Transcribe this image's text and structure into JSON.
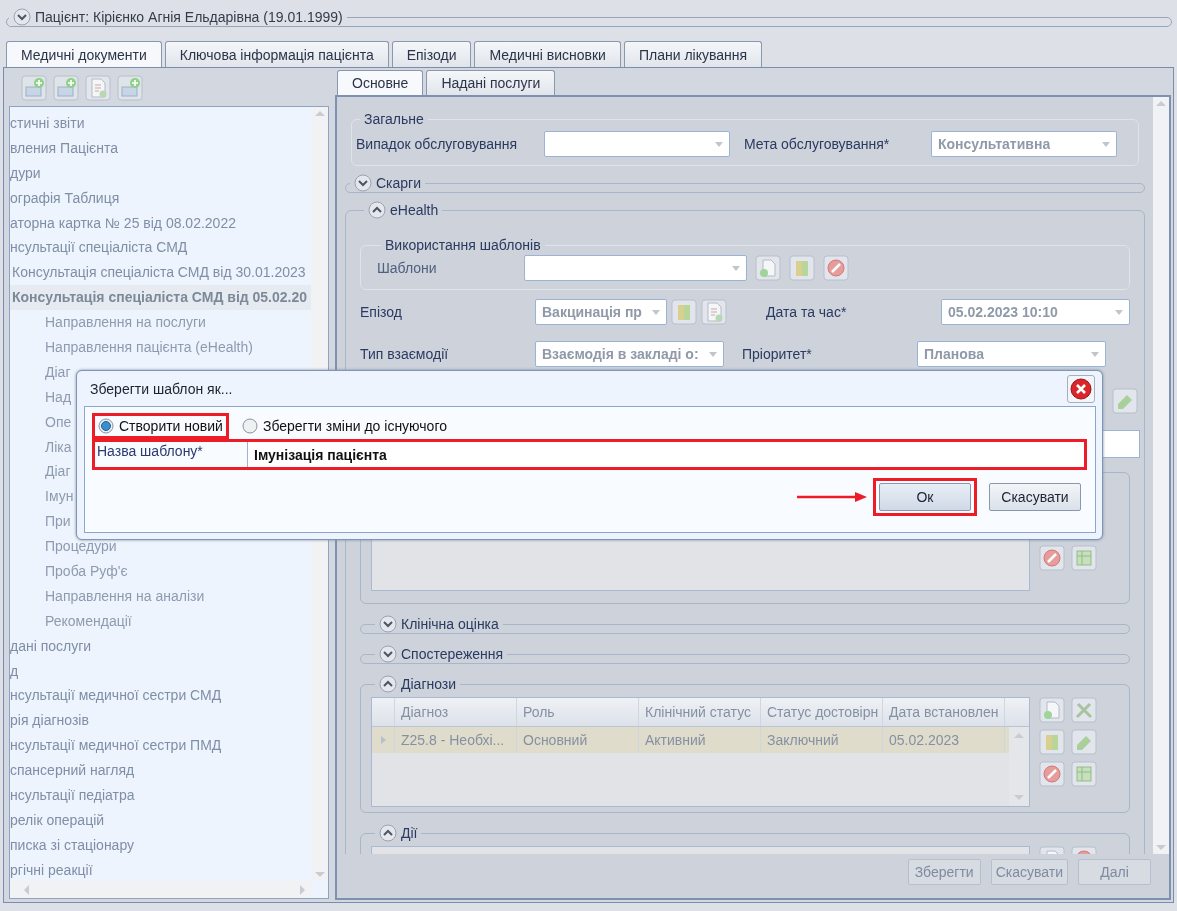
{
  "header": {
    "title": "Пацієнт: Кірієнко Агнія Ельдарівна (19.01.1999)",
    "expanded": false
  },
  "tabs": [
    {
      "label": "Медичні документи",
      "selected": true
    },
    {
      "label": "Ключова інформація пацієнта",
      "selected": false
    },
    {
      "label": "Епізоди",
      "selected": false
    },
    {
      "label": "Медичні висновки",
      "selected": false
    },
    {
      "label": "Плани лікування",
      "selected": false
    }
  ],
  "tree": {
    "items": [
      {
        "label": "стичні звіти",
        "selected": false
      },
      {
        "label": "вления Пацієнта",
        "selected": false
      },
      {
        "label": "дури",
        "selected": false
      },
      {
        "label": "ографія Таблиця",
        "selected": false
      },
      {
        "label": "аторна картка № 25 від 08.02.2022",
        "selected": false
      },
      {
        "label": "нсультації спеціаліста СМД",
        "selected": false,
        "children": [
          {
            "label": "Консультація спеціаліста СМД від 30.01.2023",
            "selected": false
          },
          {
            "label": "Консультація спеціаліста СМД від 05.02.20",
            "selected": true,
            "children": [
              {
                "label": "Направлення на послуги",
                "selected": false
              },
              {
                "label": "Направлення пацієнта (eHealth)",
                "selected": false
              },
              {
                "label": "Діаг",
                "selected": false
              },
              {
                "label": "Над",
                "selected": false
              },
              {
                "label": "Опе",
                "selected": false
              },
              {
                "label": "Ліка",
                "selected": false
              },
              {
                "label": "Діаг",
                "selected": false
              },
              {
                "label": "Імун",
                "selected": false
              },
              {
                "label": "При",
                "selected": false
              },
              {
                "label": "Процедури",
                "selected": false
              },
              {
                "label": "Проба Руф'є",
                "selected": false
              },
              {
                "label": "Направлення на аналізи",
                "selected": false
              },
              {
                "label": "Рекомендації",
                "selected": false
              }
            ]
          }
        ]
      },
      {
        "label": "дані послуги",
        "selected": false
      },
      {
        "label": "д",
        "selected": false
      },
      {
        "label": "нсультації медичної сестри СМД",
        "selected": false
      },
      {
        "label": "рія діагнозів",
        "selected": false
      },
      {
        "label": "нсультації медичної сестри ПМД",
        "selected": false
      },
      {
        "label": "спансерний нагляд",
        "selected": false
      },
      {
        "label": "нсультації педіатра",
        "selected": false
      },
      {
        "label": "релік операцій",
        "selected": false
      },
      {
        "label": "писка зі стаціонару",
        "selected": false
      },
      {
        "label": "ргічні реакції",
        "selected": false
      }
    ]
  },
  "subtabs": [
    {
      "label": "Основне",
      "selected": true
    },
    {
      "label": "Надані послуги",
      "selected": false
    }
  ],
  "general": {
    "title": "Загальне",
    "fields": [
      {
        "label": "Випадок обслуговування"
      },
      {
        "label": "Мета обслуговування*",
        "value": "Консультативна"
      }
    ]
  },
  "complaints": {
    "title": "Скарги",
    "expanded": false
  },
  "ehealth": {
    "title": "eHealth",
    "expanded": true,
    "templates": {
      "title": "Використання шаблонів",
      "label": "Шаблони"
    },
    "fields": [
      {
        "label": "Епізод",
        "value": "Вакцинація пр"
      },
      {
        "label": "Дата та час*",
        "value": "05.02.2023 10:10"
      },
      {
        "label": "Тип взаємодії",
        "value": "Взаємодія в закладі о:"
      },
      {
        "label": "Пріоритет*",
        "value": "Планова"
      }
    ],
    "subsections": [
      {
        "title": "Клінічна оцінка",
        "expanded": false
      },
      {
        "title": "Спостереження",
        "expanded": false
      },
      {
        "title": "Діагнози",
        "expanded": true,
        "table": {
          "columns": [
            "Діагноз",
            "Роль",
            "Клінічний статус",
            "Статус достовірн",
            "Дата встановлен"
          ],
          "rows": [
            {
              "selected": true,
              "cells": [
                "Z25.8 - Необхі...",
                "Основний",
                "Активний",
                "Заключний",
                "05.02.2023"
              ]
            }
          ]
        }
      },
      {
        "title": "Дії",
        "expanded": true
      }
    ]
  },
  "footer_buttons": [
    {
      "label": "Зберегти"
    },
    {
      "label": "Скасувати"
    },
    {
      "label": "Далі"
    }
  ],
  "dialog": {
    "title": "Зберегти шаблон як...",
    "options": [
      {
        "label": "Створити новий",
        "selected": true,
        "highlighted": true
      },
      {
        "label": "Зберегти зміни до існуючого",
        "selected": false,
        "highlighted": false
      }
    ],
    "name_field": {
      "label": "Назва шаблону*",
      "value": "Імунізація пацієнта",
      "highlighted": true
    },
    "buttons": [
      {
        "label": "Ок",
        "kind": "primary",
        "highlighted": true
      },
      {
        "label": "Скасувати",
        "kind": "secondary",
        "highlighted": false
      }
    ]
  }
}
